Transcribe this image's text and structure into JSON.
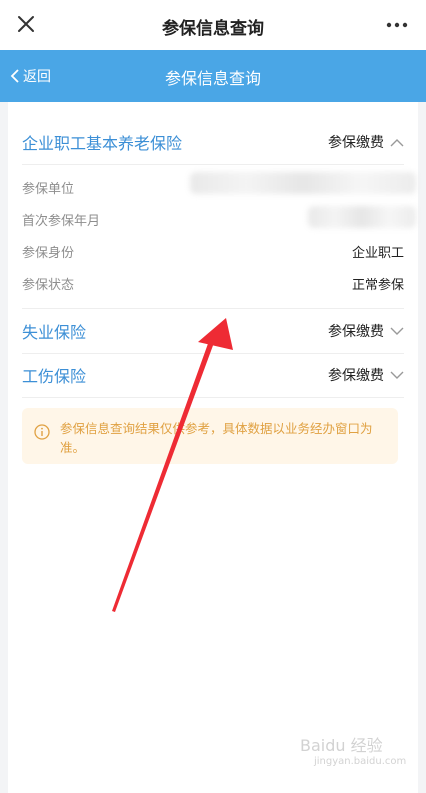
{
  "topbar": {
    "title": "参保信息查询"
  },
  "navbar": {
    "back_label": "返回",
    "title": "参保信息查询"
  },
  "sections": [
    {
      "title": "企业职工基本养老保险",
      "action": "参保缴费",
      "expanded": true,
      "details": [
        {
          "label": "参保单位",
          "value": ""
        },
        {
          "label": "首次参保年月",
          "value": ""
        },
        {
          "label": "参保身份",
          "value": "企业职工"
        },
        {
          "label": "参保状态",
          "value": "正常参保"
        }
      ]
    },
    {
      "title": "失业保险",
      "action": "参保缴费",
      "expanded": false
    },
    {
      "title": "工伤保险",
      "action": "参保缴费",
      "expanded": false
    }
  ],
  "notice": {
    "text": "参保信息查询结果仅供参考，具体数据以业务经办窗口为准。"
  },
  "watermark": {
    "brand": "Baidu 经验",
    "url": "jingyan.baidu.com"
  },
  "colors": {
    "nav_blue": "#4aa6e6",
    "title_blue": "#3c8fd6",
    "notice_bg": "#fff6e8",
    "notice_text": "#e0a142",
    "arrow_red": "#ee2b34"
  }
}
